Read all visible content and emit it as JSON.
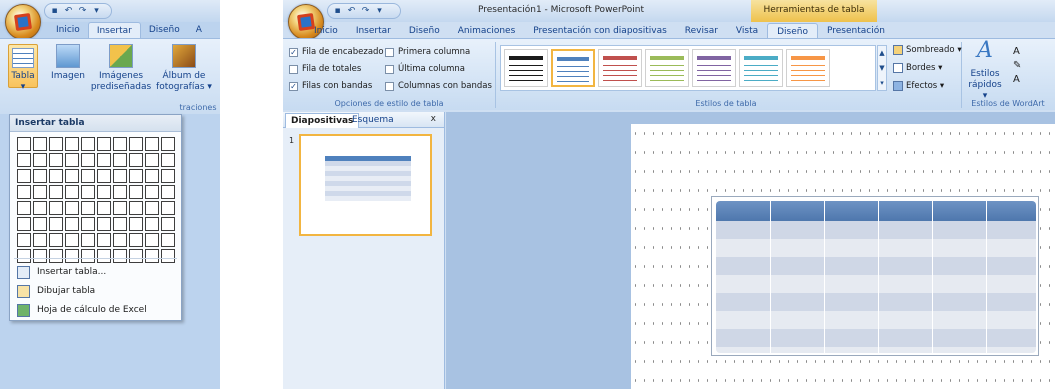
{
  "left": {
    "qat_icons": [
      "save-icon",
      "undo-icon",
      "dropdown-icon"
    ],
    "tabs": [
      {
        "label": "Inicio"
      },
      {
        "label": "Insertar"
      },
      {
        "label": "Diseño"
      },
      {
        "label": "A"
      }
    ],
    "ribbon": {
      "table_label": "Tabla",
      "image_label": "Imagen",
      "clipart_label_1": "Imágenes",
      "clipart_label_2": "prediseñadas",
      "album_label_1": "Álbum de",
      "album_label_2": "fotografías ▾",
      "group_label": "traciones"
    },
    "dropdown": {
      "title": "Insertar tabla",
      "items": [
        {
          "label": "Insertar tabla...",
          "icon": "table-icon"
        },
        {
          "label": "Dibujar tabla",
          "icon": "pencil-icon"
        },
        {
          "label": "Hoja de cálculo de Excel",
          "icon": "excel-icon"
        }
      ]
    }
  },
  "right": {
    "window_title": "Presentación1 - Microsoft PowerPoint",
    "context_title": "Herramientas de tabla",
    "tabs": [
      {
        "label": "Inicio"
      },
      {
        "label": "Insertar"
      },
      {
        "label": "Diseño"
      },
      {
        "label": "Animaciones"
      },
      {
        "label": "Presentación con diapositivas"
      },
      {
        "label": "Revisar"
      },
      {
        "label": "Vista"
      },
      {
        "label": "Diseño"
      },
      {
        "label": "Presentación"
      }
    ],
    "options": {
      "header_row": "Fila de encabezado",
      "total_row": "Fila de totales",
      "banded_rows": "Filas con bandas",
      "first_column": "Primera columna",
      "last_column": "Última columna",
      "banded_columns": "Columnas con bandas",
      "group_label": "Opciones de estilo de tabla"
    },
    "styles": {
      "group_label": "Estilos de tabla",
      "swatch_colors": [
        "#1a1a1a",
        "#4f81bd",
        "#c0504d",
        "#9bbb59",
        "#8064a2",
        "#4bacc6",
        "#f79646"
      ]
    },
    "commands": {
      "shading": "Sombreado ▾",
      "borders": "Bordes ▾",
      "effects": "Efectos ▾",
      "quick_styles_1": "Estilos",
      "quick_styles_2": "rápidos ▾",
      "wordart_label": "Estilos de WordArt"
    },
    "pane": {
      "tab_slides": "Diapositivas",
      "tab_outline": "Esquema",
      "close": "x",
      "slide_number": "1"
    }
  }
}
